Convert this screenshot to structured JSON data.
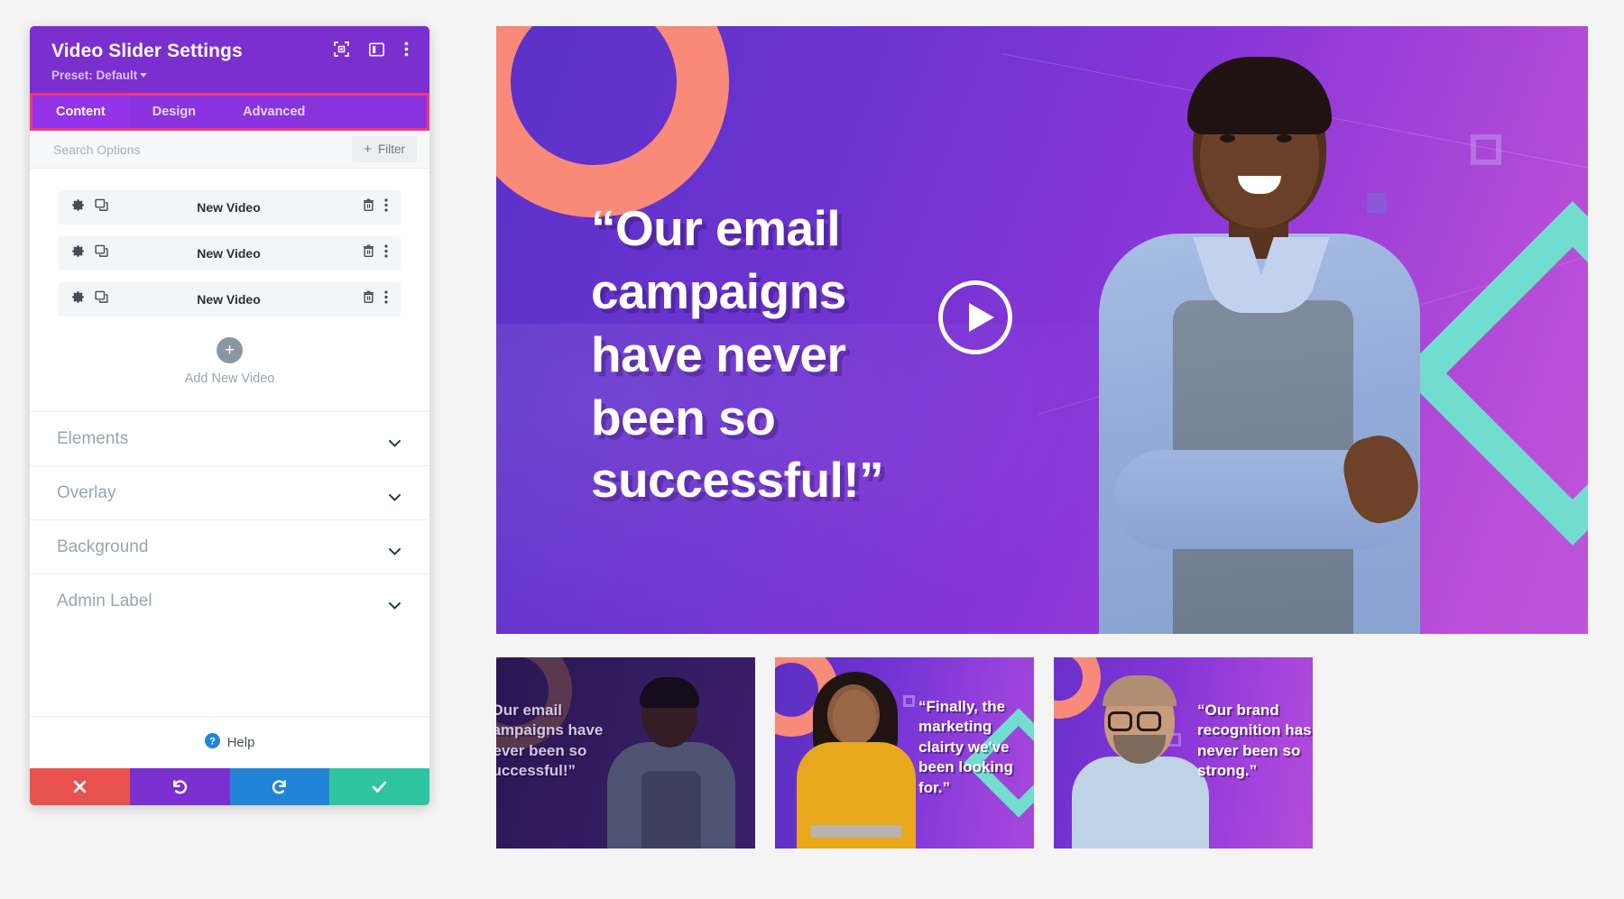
{
  "panel": {
    "title": "Video Slider Settings",
    "preset_label": "Preset: Default",
    "header_icons": [
      "focus-target-icon",
      "panel-layout-icon",
      "more-vertical-icon"
    ],
    "tabs": [
      {
        "label": "Content",
        "active": true
      },
      {
        "label": "Design",
        "active": false
      },
      {
        "label": "Advanced",
        "active": false
      }
    ],
    "search": {
      "placeholder": "Search Options",
      "value": ""
    },
    "filter_button": {
      "label": "Filter",
      "plus": "+"
    },
    "video_items": [
      {
        "title": "New Video"
      },
      {
        "title": "New Video"
      },
      {
        "title": "New Video"
      }
    ],
    "row_icons": {
      "settings": "gear-icon",
      "duplicate": "duplicate-icon",
      "delete": "trash-icon",
      "more": "more-vertical-icon"
    },
    "add_new": {
      "plus": "+",
      "label": "Add New Video"
    },
    "sections": [
      {
        "label": "Elements",
        "expanded": false
      },
      {
        "label": "Overlay",
        "expanded": false
      },
      {
        "label": "Background",
        "expanded": false
      },
      {
        "label": "Admin Label",
        "expanded": false
      }
    ],
    "help": {
      "label": "Help",
      "icon": "question-circle-icon"
    },
    "footer_buttons": [
      {
        "name": "cancel",
        "glyph": "✖",
        "color": "#E8524E"
      },
      {
        "name": "undo",
        "glyph": "↺",
        "color": "#7B2FCE"
      },
      {
        "name": "redo",
        "glyph": "↻",
        "color": "#2284D6"
      },
      {
        "name": "save",
        "glyph": "✔",
        "color": "#2EC4A0"
      }
    ],
    "colors": {
      "header_purple": "#7B2FCE",
      "tab_active": "#9333EA",
      "tab_highlight_border": "#F0377F"
    }
  },
  "preview": {
    "main_slide": {
      "quote": "“Our email campaigns have never been so successful!”",
      "play_button": "play-icon"
    },
    "thumbnails": [
      {
        "quote": "“Our email campaigns have never been so successful!”",
        "active": true
      },
      {
        "quote": "“Finally, the marketing clairty we've been looking for.”",
        "active": false
      },
      {
        "quote": "“Our brand recognition has never been so strong.”",
        "active": false
      }
    ]
  }
}
